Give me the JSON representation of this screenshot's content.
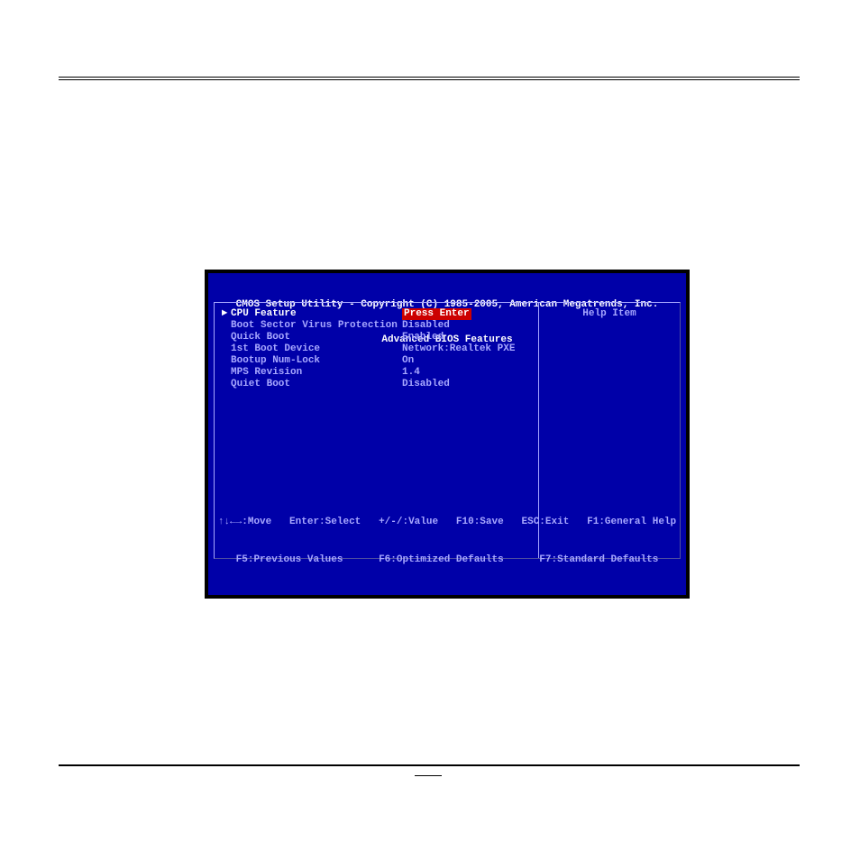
{
  "header": {
    "line1": "CMOS Setup Utility - Copyright (C) 1985-2005, American Megatrends, Inc.",
    "line2": "Advanced BIOS Features"
  },
  "settings": [
    {
      "marker": "►",
      "label": "CPU Feature",
      "value": "Press Enter",
      "selected": true
    },
    {
      "marker": " ",
      "label": "Boot Sector Virus Protection",
      "value": "Disabled",
      "selected": false
    },
    {
      "marker": " ",
      "label": "Quick Boot",
      "value": "Enabled",
      "selected": false
    },
    {
      "marker": " ",
      "label": "1st Boot Device",
      "value": "Network:Realtek PXE",
      "selected": false
    },
    {
      "marker": " ",
      "label": "Bootup Num-Lock",
      "value": "On",
      "selected": false
    },
    {
      "marker": " ",
      "label": "MPS Revision",
      "value": "1.4",
      "selected": false
    },
    {
      "marker": " ",
      "label": "Quiet Boot",
      "value": "Disabled",
      "selected": false
    }
  ],
  "help": {
    "title": "Help Item"
  },
  "footer": {
    "line1": "↑↓←→:Move   Enter:Select   +/-/:Value   F10:Save   ESC:Exit   F1:General Help",
    "line2": "F5:Previous Values      F6:Optimized Defaults      F7:Standard Defaults"
  }
}
